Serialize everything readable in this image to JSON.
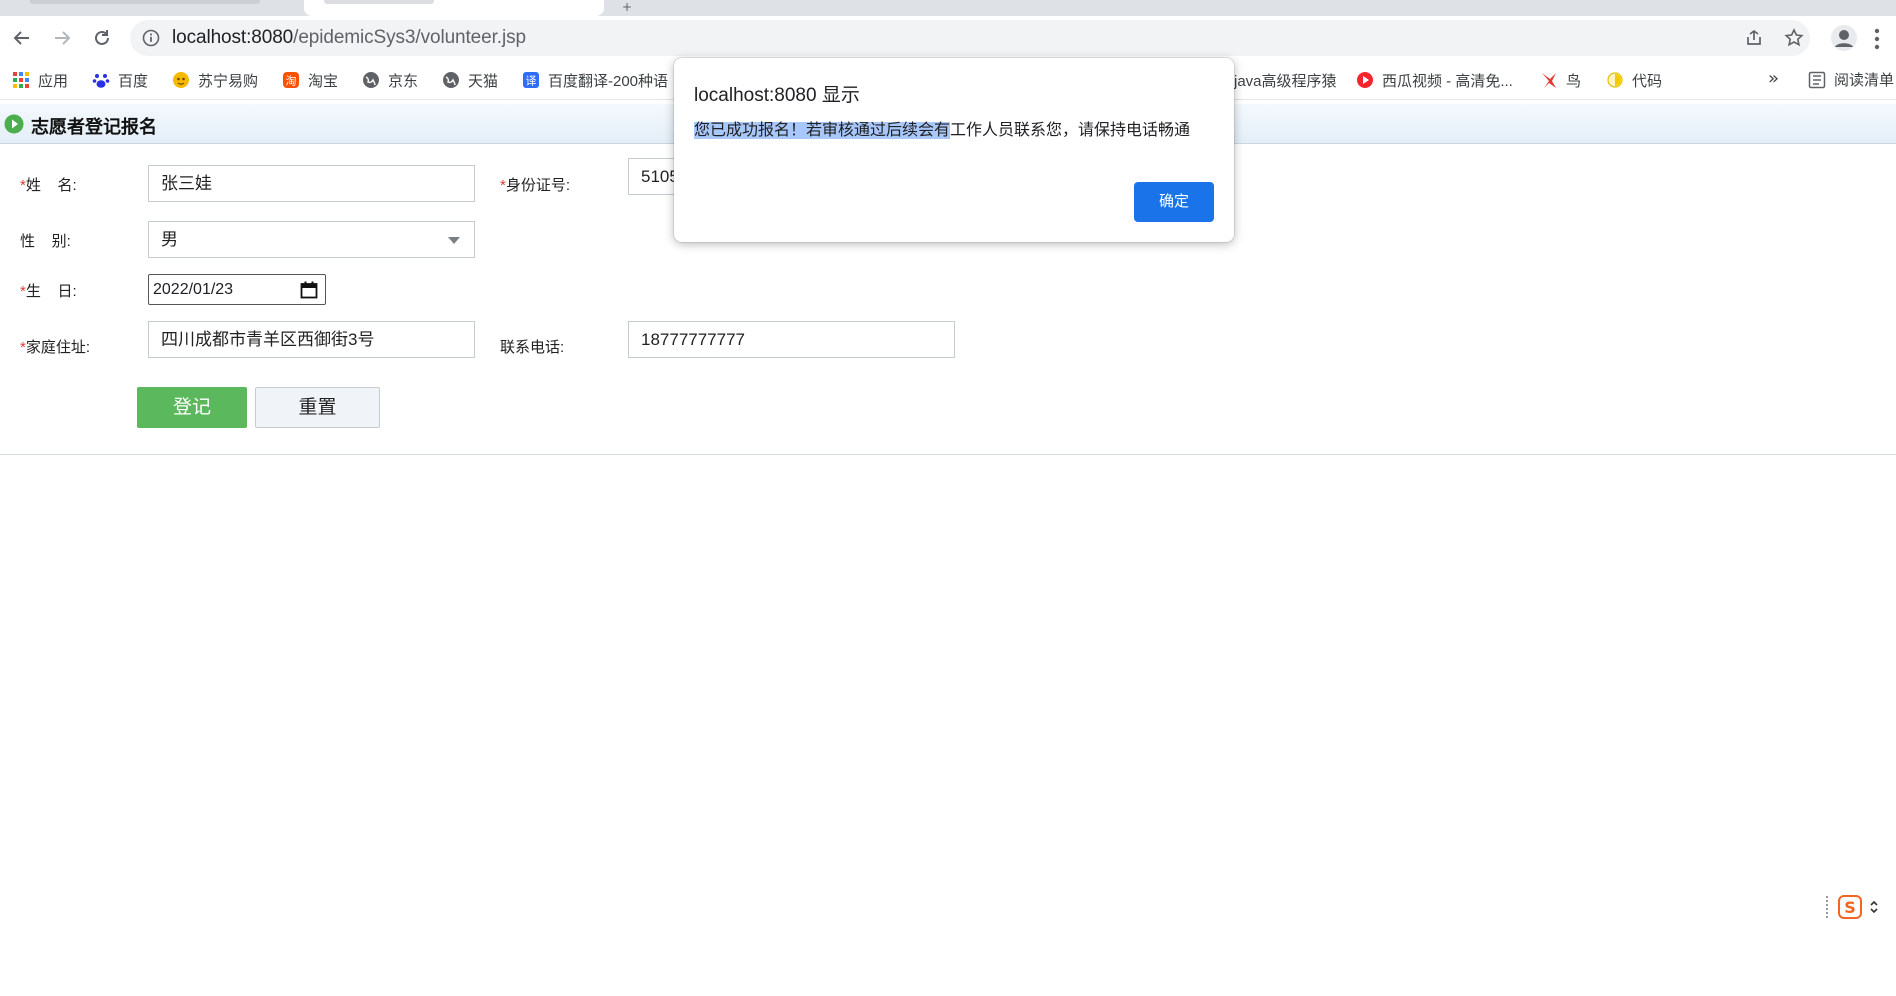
{
  "browser": {
    "url_host": "localhost:8080",
    "url_path": "/epidemicSys3/volunteer.jsp",
    "bookmarks": [
      {
        "label": "应用",
        "icon": "apps-grid-icon",
        "color": "#4285f4"
      },
      {
        "label": "百度",
        "icon": "baidu-paw-icon",
        "color": "#2932e1"
      },
      {
        "label": "苏宁易购",
        "icon": "suning-icon",
        "color": "#f6b800"
      },
      {
        "label": "淘宝",
        "icon": "taobao-icon",
        "color": "#ff5000"
      },
      {
        "label": "京东",
        "icon": "globe-icon",
        "color": "#5f6368"
      },
      {
        "label": "天猫",
        "icon": "globe-icon",
        "color": "#5f6368"
      },
      {
        "label": "百度翻译-200种语",
        "icon": "translate-icon",
        "color": "#2f6df6"
      },
      {
        "label": "java高级程序猿",
        "icon": "none",
        "color": "#5f6368"
      },
      {
        "label": "西瓜视频 - 高清免...",
        "icon": "xigua-icon",
        "color": "#f6272c"
      },
      {
        "label": "鸟",
        "icon": "bird-icon",
        "color": "#e53935"
      },
      {
        "label": "代码",
        "icon": "code-icon",
        "color": "#f6c900"
      }
    ],
    "bookmarks_more": "»",
    "reading_list": "阅读清单"
  },
  "panel": {
    "title": "志愿者登记报名"
  },
  "form": {
    "required_mark": "*",
    "name_label": "姓    名:",
    "name_value": "张三娃",
    "idcard_label": "身份证号:",
    "idcard_value": "5105",
    "gender_label": "性    别:",
    "gender_value": "男",
    "birthday_label": "生    日:",
    "birthday_value": "2022/01/23",
    "address_label": "家庭住址:",
    "address_value": "四川成都市青羊区西御街3号",
    "phone_label": "联系电话:",
    "phone_value": "18777777777",
    "submit_label": "登记",
    "reset_label": "重置"
  },
  "dialog": {
    "title": "localhost:8080 显示",
    "message_selected": "您已成功报名！若审核通过后续会有",
    "message_rest": "工作人员联系您，请保持电话畅通",
    "ok_label": "确定"
  },
  "ime": {
    "logo": "S"
  },
  "colors": {
    "primary_button": "#5cb85c",
    "dialog_button": "#1a73e8",
    "required": "#e53935",
    "selection": "#a8c7fa"
  }
}
